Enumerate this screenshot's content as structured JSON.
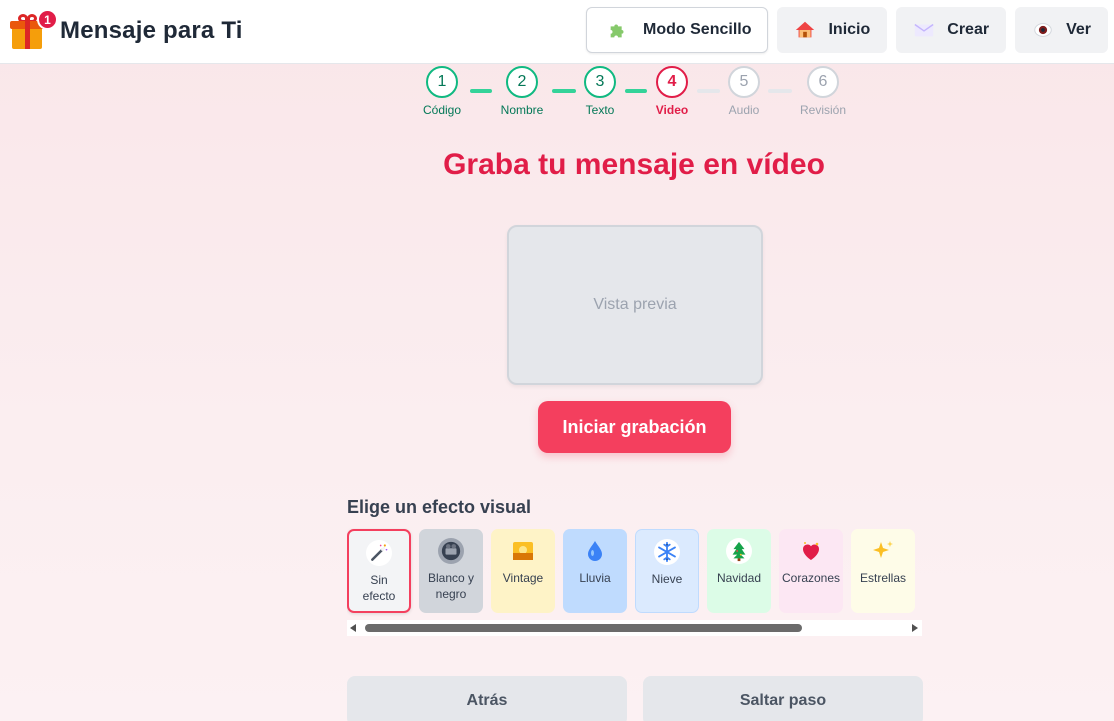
{
  "header": {
    "brand_title": "Mensaje para Ti",
    "notification_count": "1",
    "nav": [
      {
        "label": "Modo Sencillo",
        "icon": "puzzle-icon"
      },
      {
        "label": "Inicio",
        "icon": "house-icon"
      },
      {
        "label": "Crear",
        "icon": "envelope-icon"
      },
      {
        "label": "Ver",
        "icon": "eye-icon"
      }
    ]
  },
  "steps": [
    {
      "number": "1",
      "label": "Código",
      "state": "done"
    },
    {
      "number": "2",
      "label": "Nombre",
      "state": "done"
    },
    {
      "number": "3",
      "label": "Texto",
      "state": "done"
    },
    {
      "number": "4",
      "label": "Video",
      "state": "active"
    },
    {
      "number": "5",
      "label": "Audio",
      "state": "todo"
    },
    {
      "number": "6",
      "label": "Revisión",
      "state": "todo"
    }
  ],
  "main": {
    "title": "Graba tu mensaje en vídeo",
    "preview_placeholder": "Vista previa",
    "record_button": "Iniciar grabación",
    "effects_title": "Elige un efecto visual",
    "effects": [
      {
        "label": "Sin efecto",
        "icon": "magic-wand-icon",
        "color": "#f3f4f6",
        "selected": true
      },
      {
        "label": "Blanco y negro",
        "icon": "film-camera-icon",
        "color": "#d1d5db"
      },
      {
        "label": "Vintage",
        "icon": "sunset-photo-icon",
        "color": "#fef3c7"
      },
      {
        "label": "Lluvia",
        "icon": "droplet-icon",
        "color": "#bfdbfe"
      },
      {
        "label": "Nieve",
        "icon": "snowflake-icon",
        "color": "#dbeafe"
      },
      {
        "label": "Navidad",
        "icon": "christmas-tree-icon",
        "color": "#dcfce7"
      },
      {
        "label": "Corazones",
        "icon": "heart-icon",
        "color": "#fce7f3"
      },
      {
        "label": "Estrellas",
        "icon": "sparkles-icon",
        "color": "#fefce8"
      }
    ]
  },
  "footer": {
    "back_button": "Atrás",
    "skip_button": "Saltar paso"
  },
  "colors": {
    "accent": "#e11d48",
    "record": "#f43f5e",
    "done": "#10b981"
  }
}
